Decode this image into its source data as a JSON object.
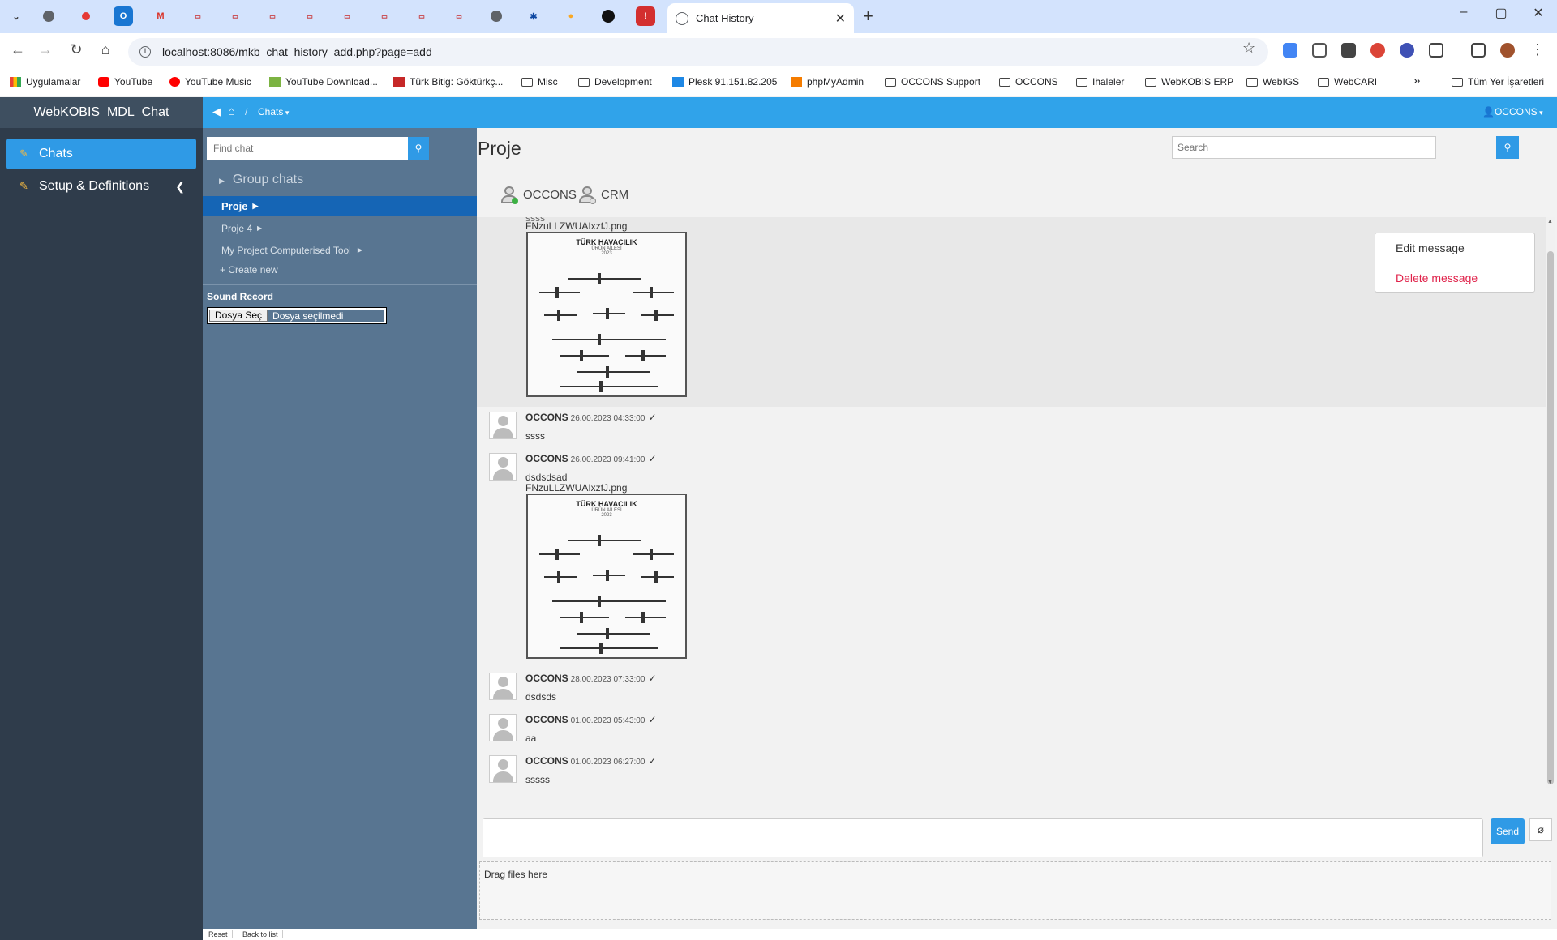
{
  "browser": {
    "tab_title": "Chat History",
    "new_tab_symbol": "+",
    "url": "localhost:8086/mkb_chat_history_add.php?page=add",
    "window_controls": [
      "–",
      "▢",
      "✕"
    ],
    "more_bookmarks": "»",
    "all_bookmarks": "Tüm Yer İşaretleri",
    "bookmarks": [
      {
        "label": "Uygulamalar",
        "icon": "apps-grid-icon"
      },
      {
        "label": "YouTube",
        "icon": "youtube-icon"
      },
      {
        "label": "YouTube Music",
        "icon": "youtube-music-icon"
      },
      {
        "label": "YouTube Download...",
        "icon": "download-icon"
      },
      {
        "label": "Türk Bitig: Göktürkç...",
        "icon": "bitig-icon"
      },
      {
        "label": "Misc",
        "icon": "folder-icon"
      },
      {
        "label": "Development",
        "icon": "folder-icon"
      },
      {
        "label": "Plesk 91.151.82.205",
        "icon": "plesk-icon"
      },
      {
        "label": "phpMyAdmin",
        "icon": "phpmyadmin-icon"
      },
      {
        "label": "OCCONS Support",
        "icon": "folder-icon"
      },
      {
        "label": "OCCONS",
        "icon": "folder-icon"
      },
      {
        "label": "Ihaleler",
        "icon": "folder-icon"
      },
      {
        "label": "WebKOBIS ERP",
        "icon": "folder-icon"
      },
      {
        "label": "WebIGS",
        "icon": "folder-icon"
      },
      {
        "label": "WebCARI",
        "icon": "folder-icon"
      }
    ]
  },
  "app": {
    "brand": "WebKOBIS_MDL_Chat",
    "sidebar": [
      {
        "label": "Chats",
        "active": true
      },
      {
        "label": "Setup & Definitions",
        "active": false
      }
    ],
    "breadcrumb": {
      "section": "Chats"
    },
    "user_menu": "OCCONS"
  },
  "chat_list": {
    "find_placeholder": "Find chat",
    "group_chats_label": "Group chats",
    "chats": [
      {
        "name": "Proje",
        "active": true
      },
      {
        "name": "Proje 4",
        "active": false
      },
      {
        "name": "My Project Computerised Tool",
        "active": false
      }
    ],
    "create_new": "+ Create new",
    "sound_record_label": "Sound Record",
    "file_button": "Dosya Seç",
    "file_status": "Dosya seçilmedi"
  },
  "conversation": {
    "title": "Proje",
    "search_placeholder": "Search",
    "members": [
      {
        "name": "OCCONS",
        "online": true
      },
      {
        "name": "CRM",
        "online": false
      }
    ],
    "messages": [
      {
        "text": "ssss",
        "attachment": "FNzuLLZWUAIxzfJ.png",
        "image_title": "TÜRK HAVACILIK",
        "image_subtitle": "ÜRÜN AİLESİ",
        "image_year": "2023"
      },
      {
        "author": "OCCONS",
        "time": "26.00.2023 04:33:00",
        "text": "ssss"
      },
      {
        "author": "OCCONS",
        "time": "26.00.2023 09:41:00",
        "text": "dsdsdsad",
        "attachment": "FNzuLLZWUAIxzfJ.png",
        "image_title": "TÜRK HAVACILIK",
        "image_subtitle": "ÜRÜN AİLESİ",
        "image_year": "2023"
      },
      {
        "author": "OCCONS",
        "time": "28.00.2023 07:33:00",
        "text": "dsdsds"
      },
      {
        "author": "OCCONS",
        "time": "01.00.2023 05:43:00",
        "text": "aa"
      },
      {
        "author": "OCCONS",
        "time": "01.00.2023 06:27:00",
        "text": "sssss"
      }
    ],
    "read_mark": "✓",
    "context_menu": {
      "edit": "Edit message",
      "delete": "Delete message"
    },
    "send_label": "Send",
    "drop_label": "Drag files here"
  },
  "bottom_tabs": [
    "Reset",
    "Back to list"
  ],
  "colors": {
    "accent": "#2f9ae6",
    "topnav": "#30a3ea",
    "sidebar": "#2f3c4b",
    "chatlist": "#587591",
    "active_chat": "#1565b5",
    "delete": "#e0224a",
    "online": "#3cb043"
  }
}
